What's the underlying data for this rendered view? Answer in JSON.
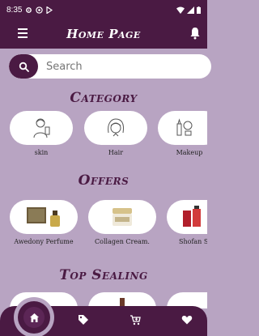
{
  "status_bar": {
    "time": "8:35"
  },
  "app_bar": {
    "title": "Home Page"
  },
  "search": {
    "placeholder": "Search"
  },
  "sections": {
    "category": {
      "title": "Category",
      "items": [
        {
          "label": "skin"
        },
        {
          "label": "Hair"
        },
        {
          "label": "Makeup"
        }
      ]
    },
    "offers": {
      "title": "Offers",
      "items": [
        {
          "label": "Awedony Perfume"
        },
        {
          "label": "Collagen Cream."
        },
        {
          "label": "Shofan S"
        }
      ]
    },
    "top_sealing": {
      "title": "Top Sealing"
    }
  },
  "bottom_nav": {
    "items": [
      "home-icon",
      "tag-icon",
      "cart-icon",
      "heart-icon"
    ],
    "active": "home-icon"
  },
  "colors": {
    "primary": "#4a1a43",
    "background": "#b8a4c2",
    "card": "#ffffff"
  }
}
